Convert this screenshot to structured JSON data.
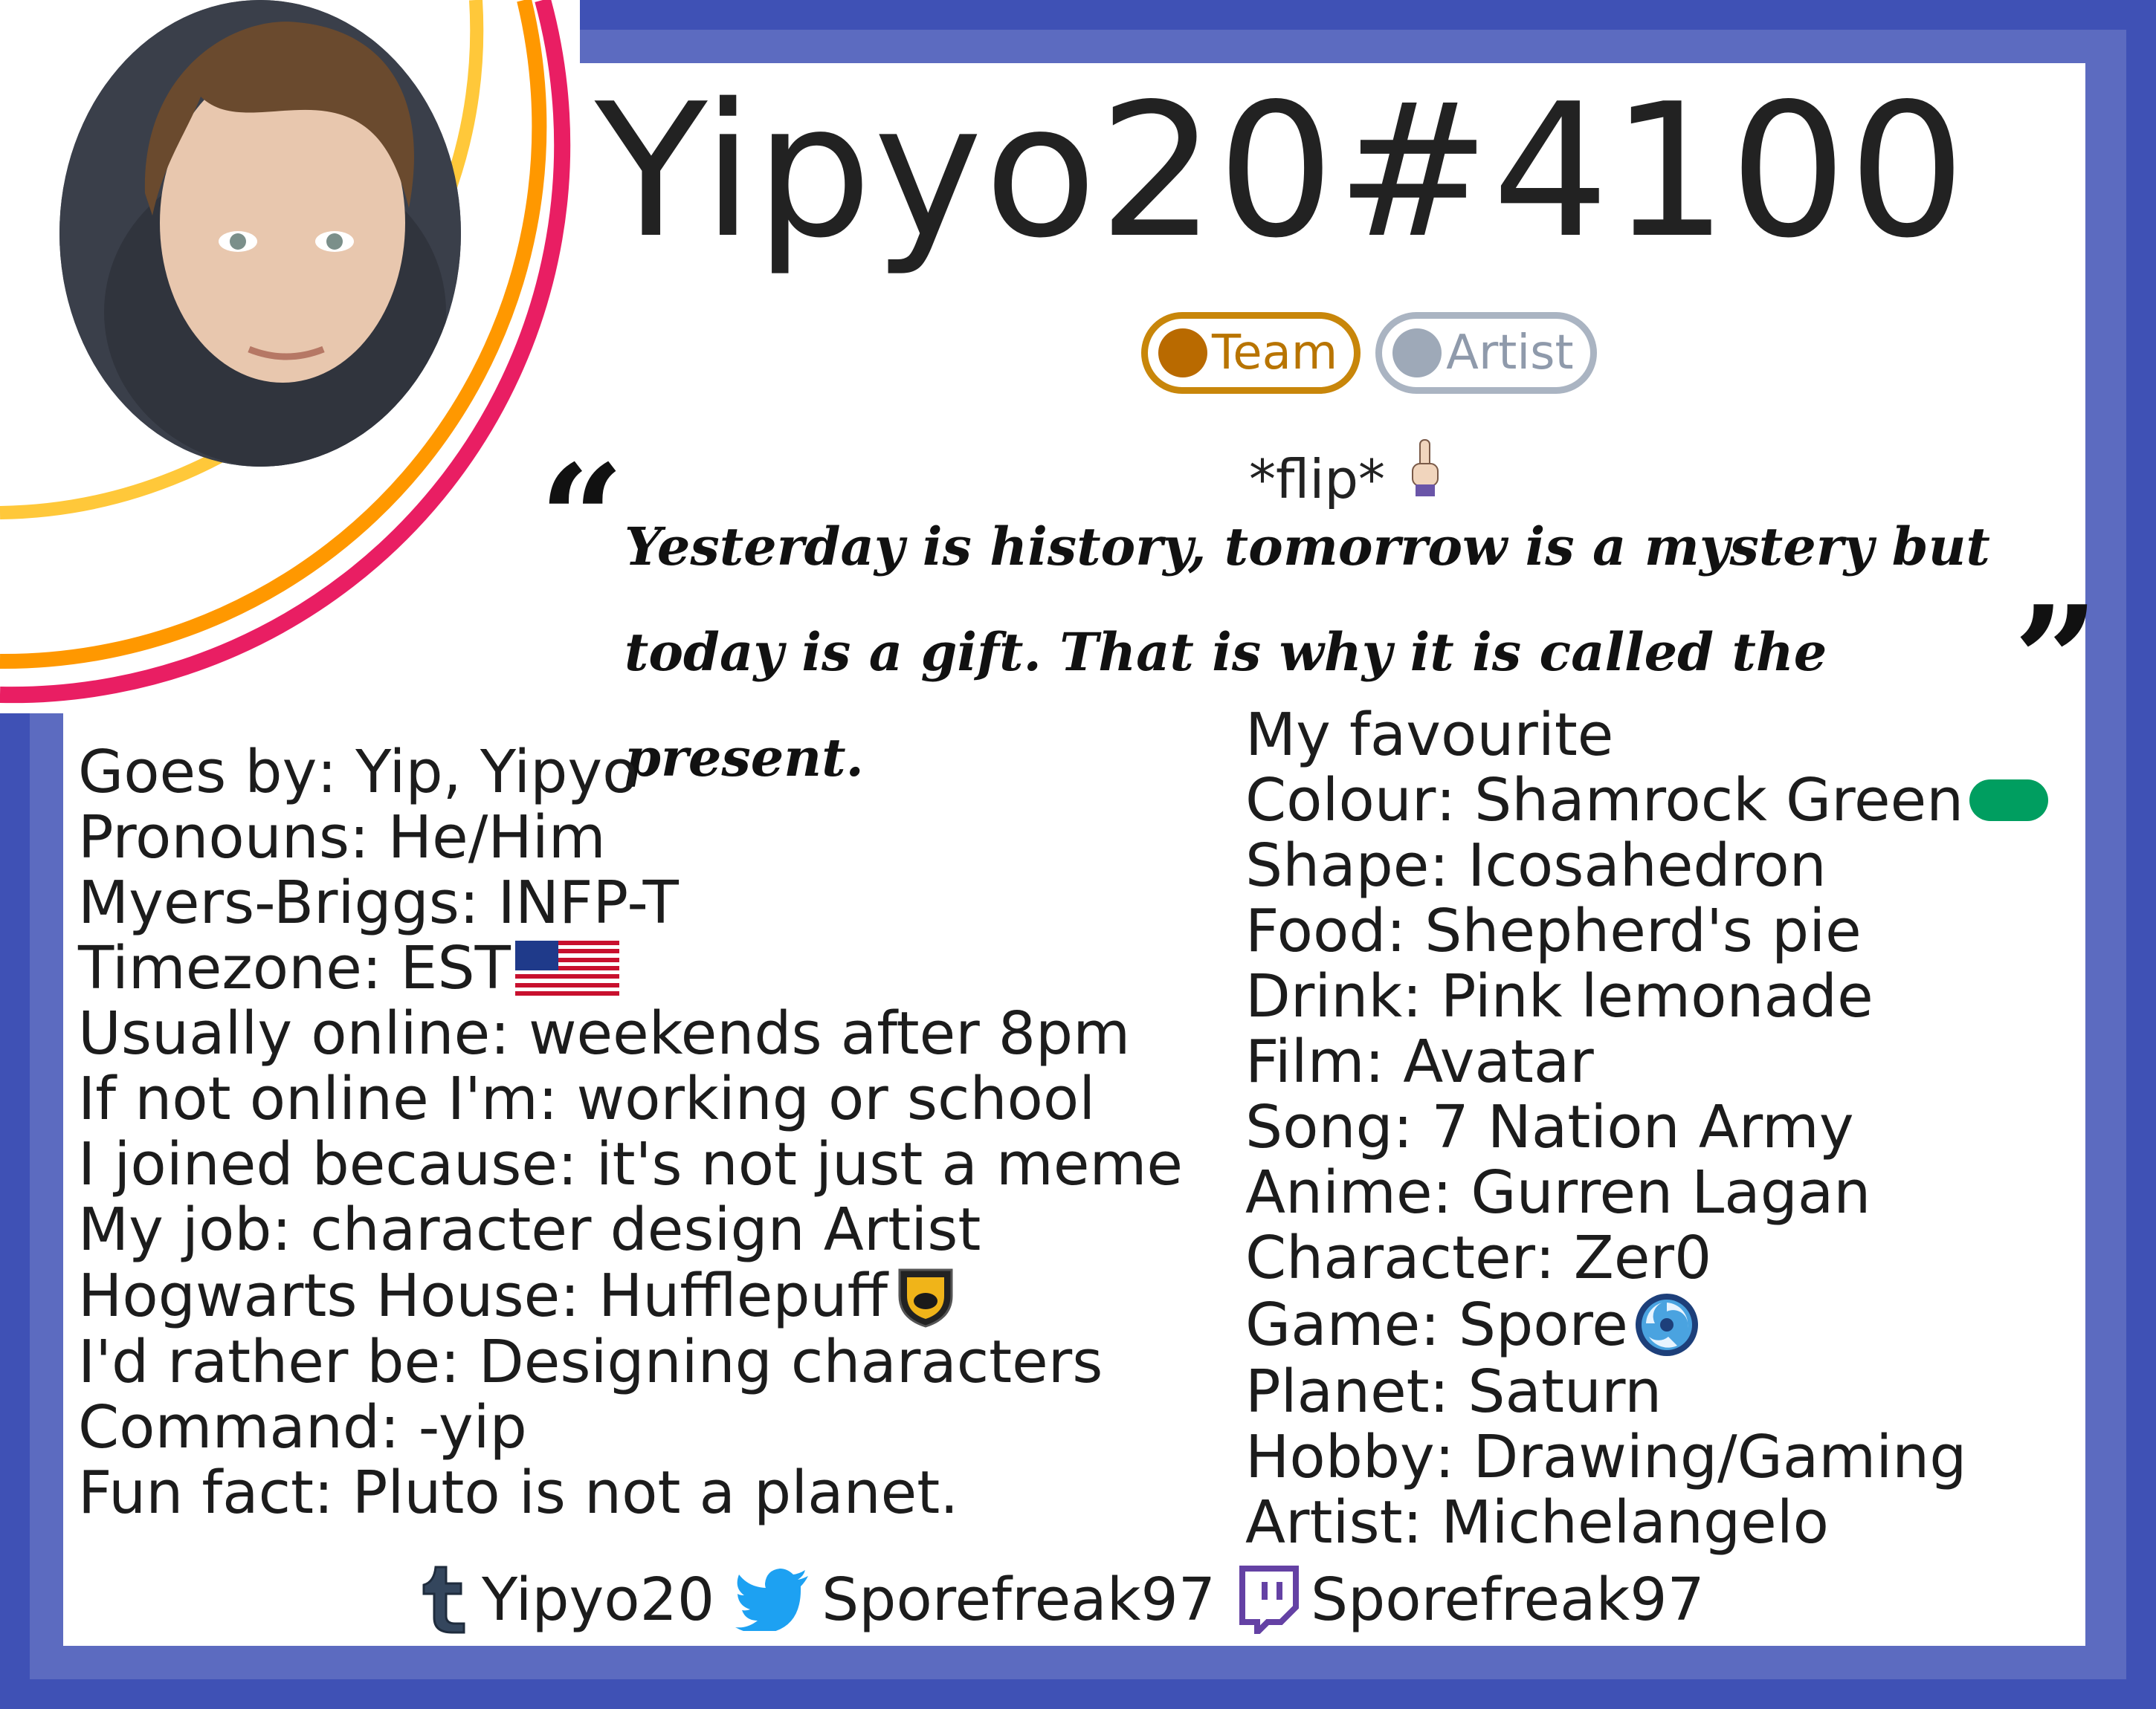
{
  "profile": {
    "username": "Yipyo20#4100",
    "badges": [
      {
        "label": "Team",
        "color": "#c8860a"
      },
      {
        "label": "Artist",
        "color": "#9ea9b8"
      }
    ],
    "flip_text": "*flip*",
    "quote": {
      "line1": "Yesterday is history, tomorrow is a mystery but",
      "line2": "today is a gift. That is why it is called the present."
    },
    "left": [
      {
        "key": "Goes by",
        "value": "Yip, Yipyo"
      },
      {
        "key": "Pronouns",
        "value": "He/Him"
      },
      {
        "key": "Myers-Briggs",
        "value": "INFP-T"
      },
      {
        "key": "Timezone",
        "value": "EST",
        "icon": "us-flag-icon"
      },
      {
        "key": "Usually online",
        "value": "weekends after 8pm"
      },
      {
        "key": "If not online I'm",
        "value": "working or school"
      },
      {
        "key": "I joined because",
        "value": "it's not just a meme"
      },
      {
        "key": "My job",
        "value": "character design Artist"
      },
      {
        "key": "Hogwarts House",
        "value": "Hufflepuff",
        "icon": "hufflepuff-crest-icon"
      },
      {
        "key": "I'd rather be",
        "value": "Designing characters"
      },
      {
        "key": "Command",
        "value": "-yip"
      },
      {
        "key": "Fun fact",
        "value": "Pluto is not a planet."
      }
    ],
    "favourites_heading": "My favourite",
    "right": [
      {
        "key": "Colour",
        "value": "Shamrock Green",
        "icon": "green-swatch-icon"
      },
      {
        "key": "Shape",
        "value": "Icosahedron"
      },
      {
        "key": "Food",
        "value": "Shepherd's pie"
      },
      {
        "key": "Drink",
        "value": "Pink lemonade"
      },
      {
        "key": "Film",
        "value": "Avatar"
      },
      {
        "key": "Song",
        "value": "7 Nation Army"
      },
      {
        "key": "Anime",
        "value": "Gurren Lagan"
      },
      {
        "key": "Character",
        "value": "Zer0"
      },
      {
        "key": "Game",
        "value": "Spore",
        "icon": "spore-icon"
      },
      {
        "key": "Planet",
        "value": "Saturn"
      },
      {
        "key": "Hobby",
        "value": "Drawing/Gaming"
      },
      {
        "key": "Artist",
        "value": "Michelangelo"
      }
    ],
    "socials": [
      {
        "icon": "tumblr-icon",
        "handle": "Yipyo20"
      },
      {
        "icon": "twitter-icon",
        "handle": "Sporefreak97"
      },
      {
        "icon": "twitch-icon",
        "handle": "Sporefreak97"
      }
    ]
  },
  "colors": {
    "frame": "#3f51b5",
    "frame_inner": "#5c6bc0",
    "arc_pink": "#e91e63",
    "arc_orange": "#ff9800",
    "arc_yellow": "#ffc83a",
    "shamrock_green": "#009e60"
  }
}
